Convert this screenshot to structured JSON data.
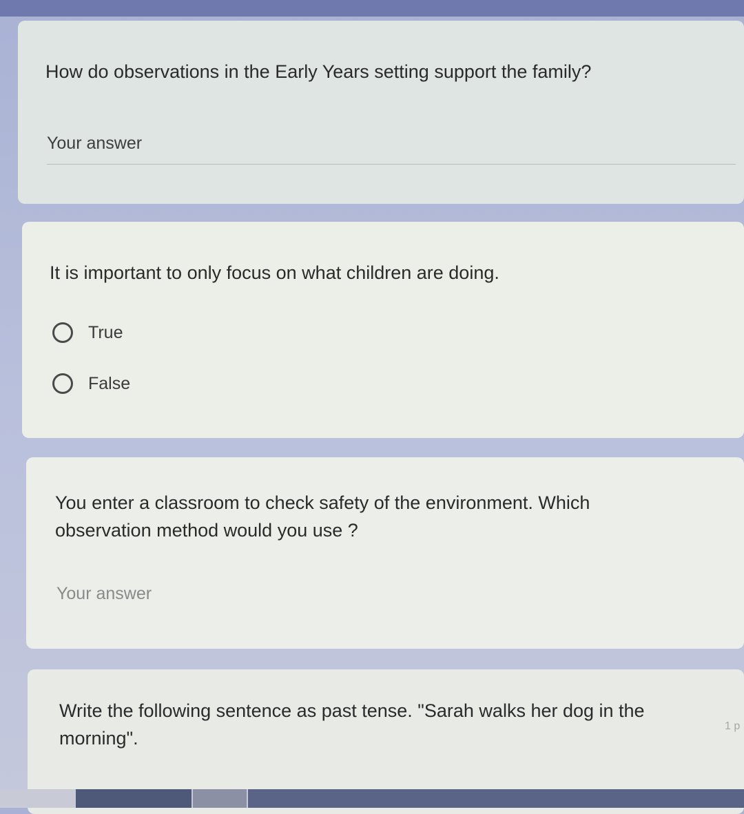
{
  "questions": [
    {
      "title": "How do observations in the Early Years setting support the family?",
      "answer_placeholder": "Your answer"
    },
    {
      "title": "It is important to only focus on what children are doing.",
      "options": [
        "True",
        "False"
      ]
    },
    {
      "title_line1": "You enter a classroom to check safety of the environment. Which",
      "title_line2": "observation method would you use ?",
      "answer_placeholder": "Your answer"
    },
    {
      "title_line1": "Write the following sentence as past tense. \"Sarah walks her dog in the",
      "title_line2": "morning\"."
    }
  ],
  "edge_fragments": {
    "right_q4": "1 p"
  },
  "icons": {
    "radio": "radio-unchecked-icon"
  },
  "colors": {
    "page_background": "#b9c0dc",
    "card_background": "#e6eae6",
    "text": "#2a2a2a"
  }
}
